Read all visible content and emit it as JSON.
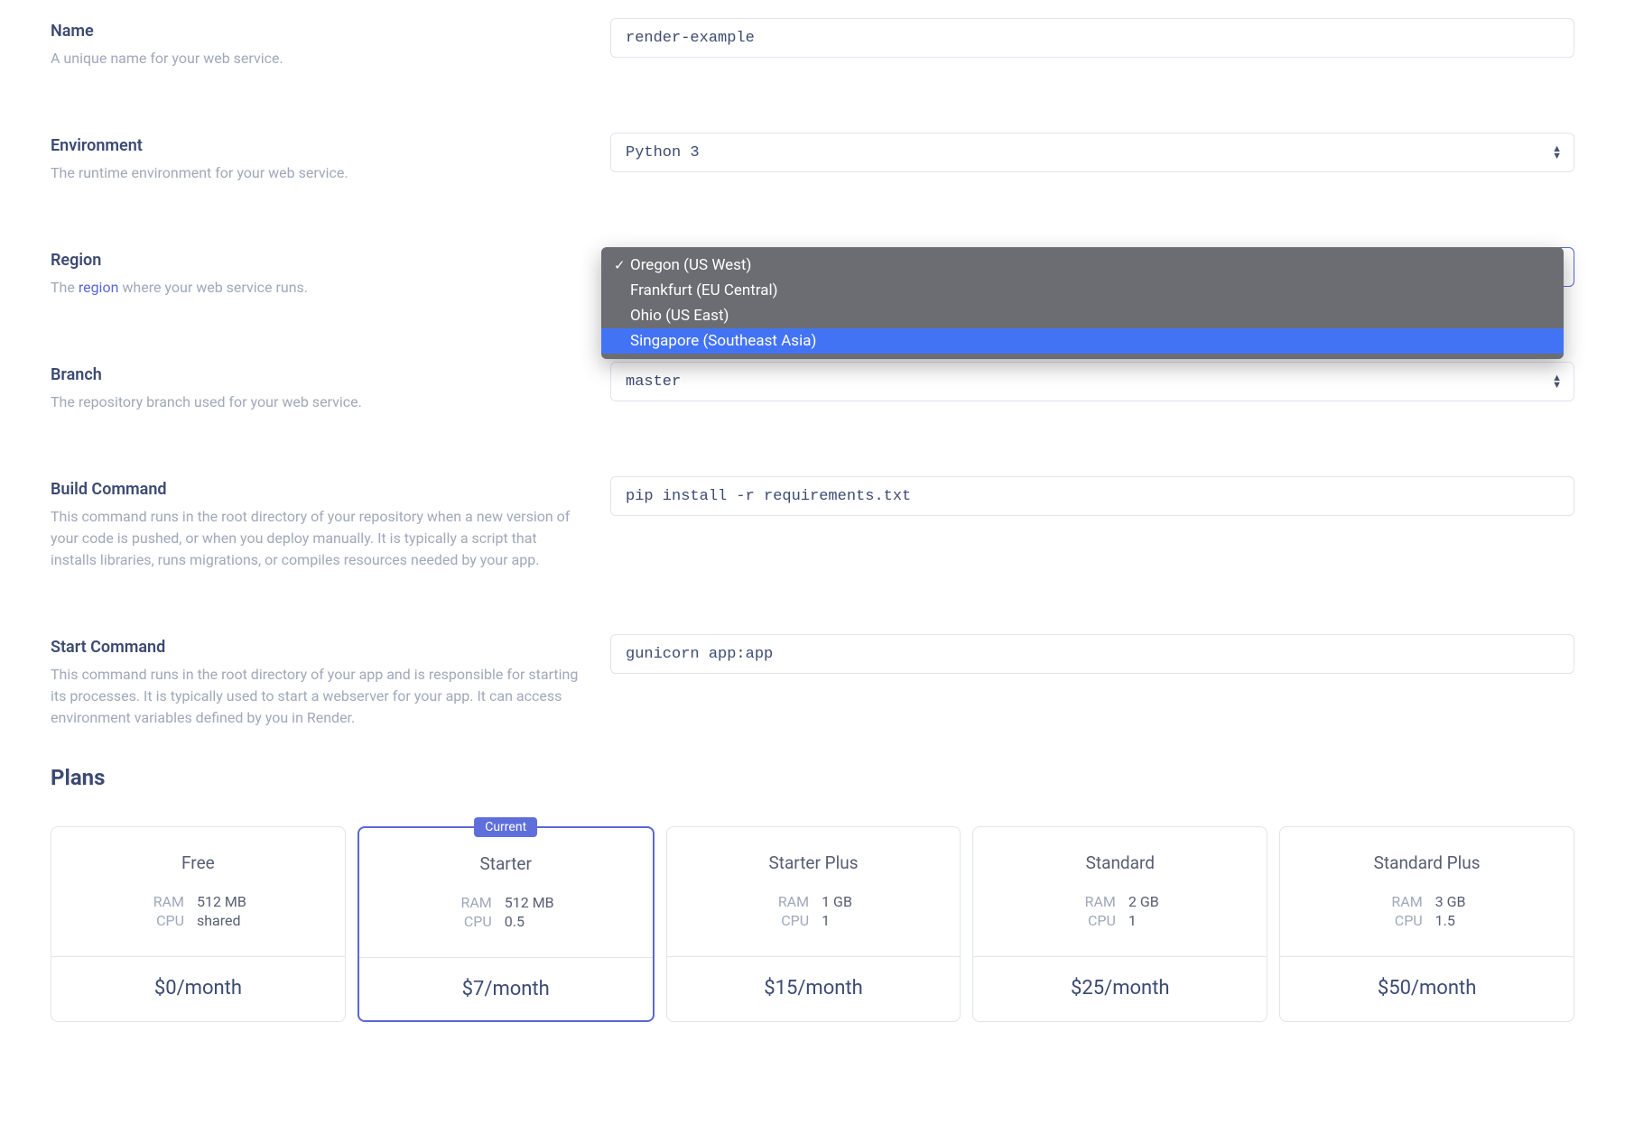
{
  "fields": {
    "name": {
      "label": "Name",
      "desc": "A unique name for your web service.",
      "value": "render-example"
    },
    "environment": {
      "label": "Environment",
      "desc": "The runtime environment for your web service.",
      "value": "Python 3"
    },
    "region": {
      "label": "Region",
      "desc_pre": "The ",
      "desc_link": "region",
      "desc_post": " where your web service runs.",
      "options": [
        {
          "label": "Oregon (US West)",
          "selected": true,
          "highlighted": false
        },
        {
          "label": "Frankfurt (EU Central)",
          "selected": false,
          "highlighted": false
        },
        {
          "label": "Ohio (US East)",
          "selected": false,
          "highlighted": false
        },
        {
          "label": "Singapore (Southeast Asia)",
          "selected": false,
          "highlighted": true
        }
      ]
    },
    "branch": {
      "label": "Branch",
      "desc": "The repository branch used for your web service.",
      "value": "master"
    },
    "build_command": {
      "label": "Build Command",
      "desc": "This command runs in the root directory of your repository when a new version of your code is pushed, or when you deploy manually. It is typically a script that installs libraries, runs migrations, or compiles resources needed by your app.",
      "value": "pip install -r requirements.txt"
    },
    "start_command": {
      "label": "Start Command",
      "desc": "This command runs in the root directory of your app and is responsible for starting its processes. It is typically used to start a webserver for your app. It can access environment variables defined by you in Render.",
      "value": "gunicorn app:app"
    }
  },
  "plans": {
    "heading": "Plans",
    "current_badge": "Current",
    "spec_labels": {
      "ram": "RAM",
      "cpu": "CPU"
    },
    "items": [
      {
        "name": "Free",
        "ram": "512 MB",
        "cpu": "shared",
        "price": "$0/month",
        "selected": false
      },
      {
        "name": "Starter",
        "ram": "512 MB",
        "cpu": "0.5",
        "price": "$7/month",
        "selected": true
      },
      {
        "name": "Starter Plus",
        "ram": "1 GB",
        "cpu": "1",
        "price": "$15/month",
        "selected": false
      },
      {
        "name": "Standard",
        "ram": "2 GB",
        "cpu": "1",
        "price": "$25/month",
        "selected": false
      },
      {
        "name": "Standard Plus",
        "ram": "3 GB",
        "cpu": "1.5",
        "price": "$50/month",
        "selected": false
      }
    ]
  }
}
